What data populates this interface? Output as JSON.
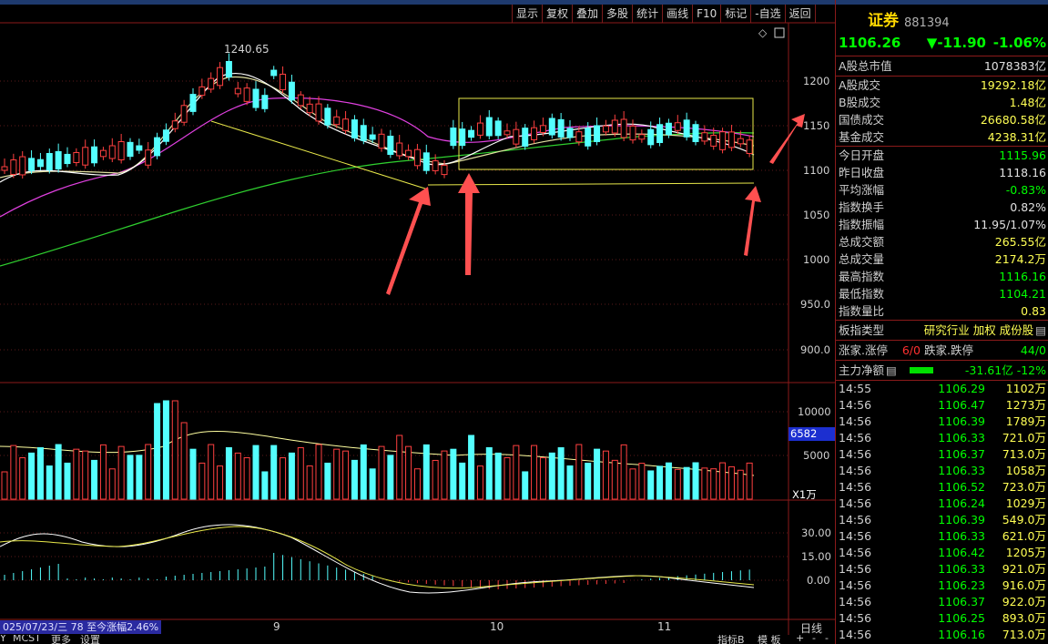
{
  "toolbar": [
    "显示",
    "复权",
    "叠加",
    "多股",
    "统计",
    "画线",
    "F10",
    "标记",
    "-自选",
    "返回"
  ],
  "header": {
    "name": "证券",
    "code": "881394",
    "price": "1106.26",
    "change": "▼-11.90",
    "pct": "-1.06%"
  },
  "market_value": {
    "label": "A股总市值",
    "value": "1078383亿"
  },
  "stats": [
    {
      "label": "A股成交",
      "value": "19292.18亿",
      "color": "yellow"
    },
    {
      "label": "B股成交",
      "value": "1.48亿",
      "color": "yellow"
    },
    {
      "label": "国债成交",
      "value": "26680.58亿",
      "color": "yellow"
    },
    {
      "label": "基金成交",
      "value": "4238.31亿",
      "color": "yellow"
    }
  ],
  "stats2": [
    {
      "label": "今日开盘",
      "value": "1115.96",
      "color": "green"
    },
    {
      "label": "昨日收盘",
      "value": "1118.16",
      "color": "white"
    },
    {
      "label": "平均涨幅",
      "value": "-0.83%",
      "color": "green"
    },
    {
      "label": "指数换手",
      "value": "0.82%",
      "color": "white"
    },
    {
      "label": "指数振幅",
      "value": "11.95/1.07%",
      "color": "white"
    },
    {
      "label": "总成交额",
      "value": "265.55亿",
      "color": "yellow"
    },
    {
      "label": "总成交量",
      "value": "2174.2万",
      "color": "yellow"
    },
    {
      "label": "最高指数",
      "value": "1116.16",
      "color": "green"
    },
    {
      "label": "最低指数",
      "value": "1104.21",
      "color": "green"
    },
    {
      "label": "指数量比",
      "value": "0.83",
      "color": "yellow"
    }
  ],
  "board": {
    "label": "板指类型",
    "value": "研究行业 加权 成份股"
  },
  "updown": {
    "label1": "涨家.涨停",
    "value1": "6/0",
    "label2": "跌家.跌停",
    "value2": "44/0"
  },
  "flow": {
    "label": "主力净额",
    "value": "-31.61亿 -12%"
  },
  "ticks": [
    {
      "t": "14:55",
      "p": "1106.29",
      "v": "1102万"
    },
    {
      "t": "14:56",
      "p": "1106.47",
      "v": "1273万"
    },
    {
      "t": "14:56",
      "p": "1106.39",
      "v": "1789万"
    },
    {
      "t": "14:56",
      "p": "1106.33",
      "v": "721.0万"
    },
    {
      "t": "14:56",
      "p": "1106.37",
      "v": "713.0万"
    },
    {
      "t": "14:56",
      "p": "1106.33",
      "v": "1058万"
    },
    {
      "t": "14:56",
      "p": "1106.52",
      "v": "723.0万"
    },
    {
      "t": "14:56",
      "p": "1106.24",
      "v": "1029万"
    },
    {
      "t": "14:56",
      "p": "1106.39",
      "v": "549.0万"
    },
    {
      "t": "14:56",
      "p": "1106.33",
      "v": "621.0万"
    },
    {
      "t": "14:56",
      "p": "1106.42",
      "v": "1205万"
    },
    {
      "t": "14:56",
      "p": "1106.33",
      "v": "921.0万"
    },
    {
      "t": "14:56",
      "p": "1106.23",
      "v": "916.0万"
    },
    {
      "t": "14:56",
      "p": "1106.37",
      "v": "922.0万"
    },
    {
      "t": "14:56",
      "p": "1106.25",
      "v": "893.0万"
    },
    {
      "t": "14:56",
      "p": "1106.16",
      "v": "713.0万"
    }
  ],
  "price_axis": [
    "1200",
    "1150",
    "1100",
    "1050",
    "1000",
    "950.0",
    "900.0"
  ],
  "vol_axis": [
    "10000",
    "5000"
  ],
  "vol_badge": "6582",
  "vol_unit": "X1万",
  "macd_axis": [
    "30.00",
    "15.00",
    "0.00"
  ],
  "high_label": "1240.65",
  "date_info": "025/07/23/三 78 至今涨幅2.46%",
  "months": [
    "9",
    "10",
    "11"
  ],
  "period": "日线",
  "bottom_tabs": [
    "Y",
    "MCST",
    "更多",
    "设置",
    "指标B",
    "模 板",
    "+",
    "-",
    "-"
  ]
}
